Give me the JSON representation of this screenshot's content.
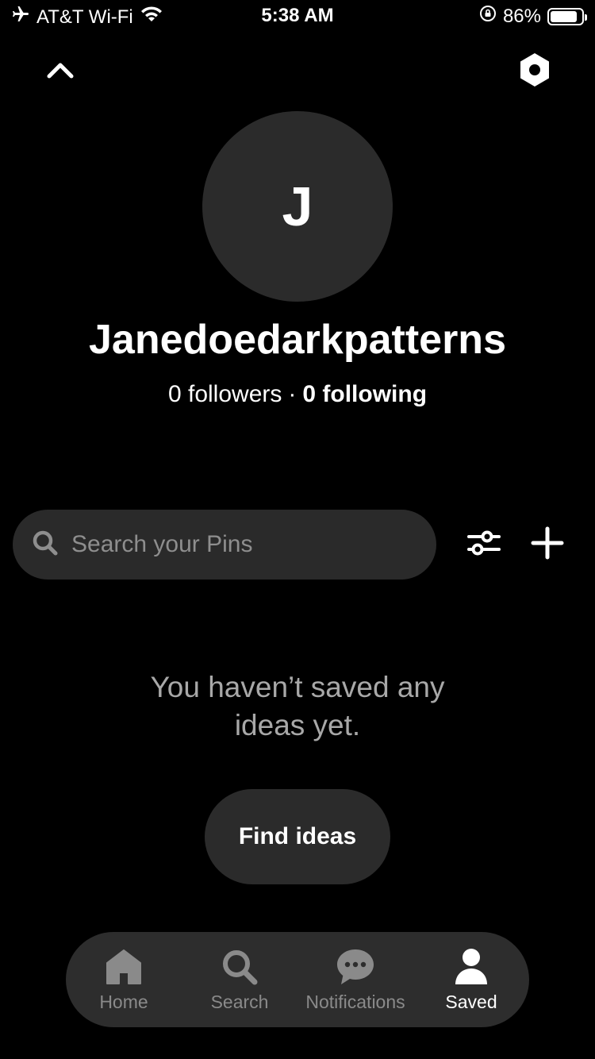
{
  "status_bar": {
    "carrier": "AT&T Wi-Fi",
    "time": "5:38 AM",
    "battery_percent": "86%",
    "battery_level": 0.86
  },
  "profile": {
    "avatar_initial": "J",
    "name": "Janedoedarkpatterns",
    "followers": "0 followers",
    "separator": "·",
    "following": "0 following"
  },
  "search": {
    "placeholder": "Search your Pins"
  },
  "empty_state": {
    "line1": "You haven’t saved any",
    "line2": "ideas yet.",
    "button_label": "Find ideas"
  },
  "tabs": [
    {
      "label": "Home",
      "icon": "home-icon",
      "active": false
    },
    {
      "label": "Search",
      "icon": "search-icon",
      "active": false
    },
    {
      "label": "Notifications",
      "icon": "chat-bubble-icon",
      "active": false
    },
    {
      "label": "Saved",
      "icon": "person-icon",
      "active": true
    }
  ],
  "colors": {
    "background": "#000000",
    "surface": "#2b2b2b",
    "muted_text": "#8e8e8e",
    "text": "#ffffff"
  }
}
